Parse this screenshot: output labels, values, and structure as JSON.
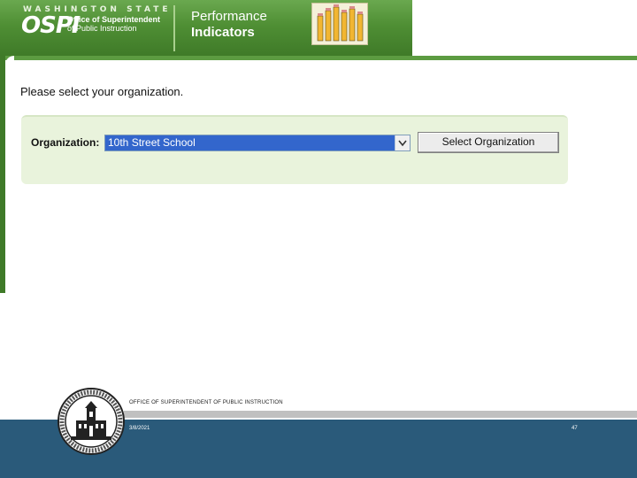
{
  "header": {
    "state_label": "WASHINGTON STATE",
    "logo_text": "OSPI",
    "office_line1": "Office of Superintendent",
    "office_line2": "of Public Instruction",
    "title_line1": "Performance",
    "title_line2": "Indicators",
    "pencils_icon": "pencils-icon"
  },
  "main": {
    "prompt": "Please select your organization.",
    "org_label": "Organization:",
    "org_selected": "10th Street School",
    "select_button": "Select Organization"
  },
  "footer": {
    "office_name": "OFFICE OF SUPERINTENDENT OF PUBLIC INSTRUCTION",
    "date": "3/8/2021",
    "page": "47",
    "seal_icon": "state-seal-icon"
  },
  "colors": {
    "banner_green": "#4f8f34",
    "panel_bg": "#e9f3dc",
    "select_highlight": "#3366cc",
    "footer_blue": "#2a5a7a"
  }
}
